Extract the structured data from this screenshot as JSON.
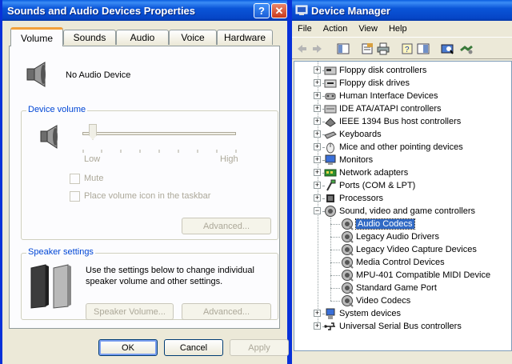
{
  "sound_window": {
    "title": "Sounds and Audio Devices Properties",
    "help_glyph": "?",
    "close_glyph": "✕",
    "tabs": [
      "Volume",
      "Sounds",
      "Audio",
      "Voice",
      "Hardware"
    ],
    "active_tab": "Volume",
    "device_name": "No Audio Device",
    "device_volume_group": "Device volume",
    "slider_low": "Low",
    "slider_high": "High",
    "mute_label": "Mute",
    "taskbar_label": "Place volume icon in the taskbar",
    "advanced_label": "Advanced...",
    "speaker_group": "Speaker settings",
    "speaker_text": "Use the settings below to change individual speaker volume and other settings.",
    "speaker_volume_label": "Speaker Volume...",
    "speaker_advanced_label": "Advanced...",
    "ok_label": "OK",
    "cancel_label": "Cancel",
    "apply_label": "Apply"
  },
  "devmgr_window": {
    "title": "Device Manager",
    "menu": [
      "File",
      "Action",
      "View",
      "Help"
    ],
    "tree": [
      {
        "label": "Floppy disk controllers",
        "icon": "floppy-controller-icon",
        "expanded": false
      },
      {
        "label": "Floppy disk drives",
        "icon": "floppy-drive-icon",
        "expanded": false
      },
      {
        "label": "Human Interface Devices",
        "icon": "hid-icon",
        "expanded": false
      },
      {
        "label": "IDE ATA/ATAPI controllers",
        "icon": "ide-controller-icon",
        "expanded": false
      },
      {
        "label": "IEEE 1394 Bus host controllers",
        "icon": "ieee1394-icon",
        "expanded": false
      },
      {
        "label": "Keyboards",
        "icon": "keyboard-icon",
        "expanded": false
      },
      {
        "label": "Mice and other pointing devices",
        "icon": "mouse-icon",
        "expanded": false
      },
      {
        "label": "Monitors",
        "icon": "monitor-icon",
        "expanded": false
      },
      {
        "label": "Network adapters",
        "icon": "network-adapter-icon",
        "expanded": false
      },
      {
        "label": "Ports (COM & LPT)",
        "icon": "port-icon",
        "expanded": false
      },
      {
        "label": "Processors",
        "icon": "processor-icon",
        "expanded": false
      },
      {
        "label": "Sound, video and game controllers",
        "icon": "speaker-icon",
        "expanded": true,
        "children": [
          {
            "label": "Audio Codecs",
            "selected": true
          },
          {
            "label": "Legacy Audio Drivers"
          },
          {
            "label": "Legacy Video Capture Devices"
          },
          {
            "label": "Media Control Devices"
          },
          {
            "label": "MPU-401 Compatible MIDI Device"
          },
          {
            "label": "Standard Game Port"
          },
          {
            "label": "Video Codecs"
          }
        ]
      },
      {
        "label": "System devices",
        "icon": "system-device-icon",
        "expanded": false
      },
      {
        "label": "Universal Serial Bus controllers",
        "icon": "usb-icon",
        "expanded": false
      }
    ]
  }
}
